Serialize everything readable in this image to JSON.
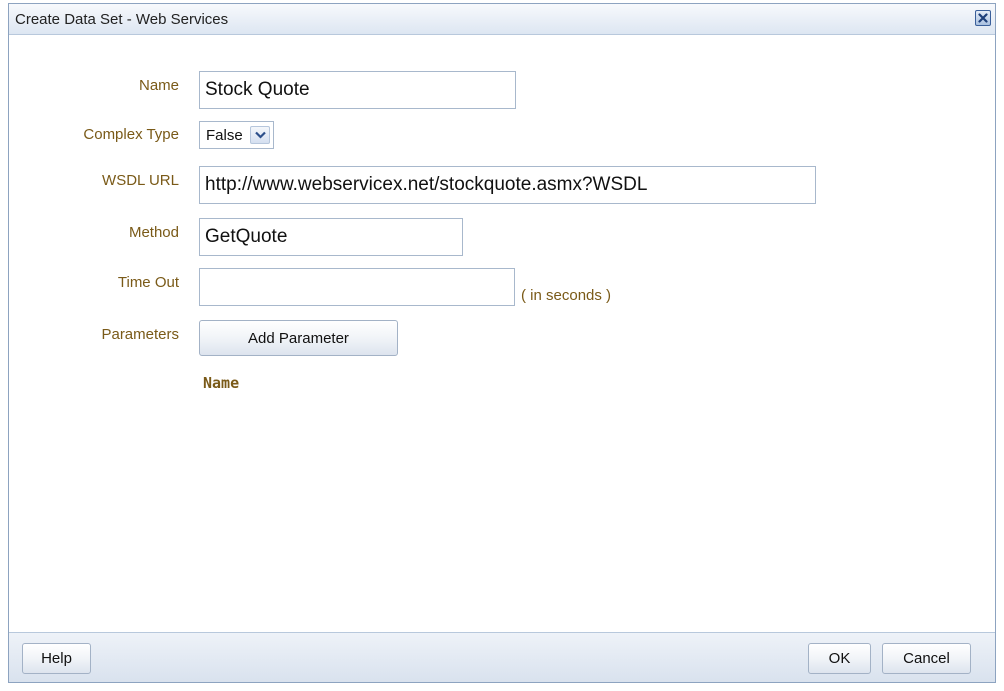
{
  "dialog": {
    "title": "Create Data Set - Web Services"
  },
  "form": {
    "name_label": "Name",
    "name_value": "Stock Quote",
    "complex_type_label": "Complex Type",
    "complex_type_value": "False",
    "wsdl_label": "WSDL URL",
    "wsdl_value": "http://www.webservicex.net/stockquote.asmx?WSDL",
    "method_label": "Method",
    "method_value": "GetQuote",
    "timeout_label": "Time Out",
    "timeout_value": "",
    "timeout_hint": "( in seconds )",
    "parameters_label": "Parameters",
    "add_parameter_label": "Add Parameter",
    "parameters_column_header": "Name"
  },
  "footer": {
    "help_label": "Help",
    "ok_label": "OK",
    "cancel_label": "Cancel"
  },
  "icons": {
    "close": "close-icon",
    "dropdown": "chevron-down-icon"
  },
  "colors": {
    "label": "#7a5a18",
    "border": "#8da3c0",
    "titlebar": "#dde6f2"
  }
}
